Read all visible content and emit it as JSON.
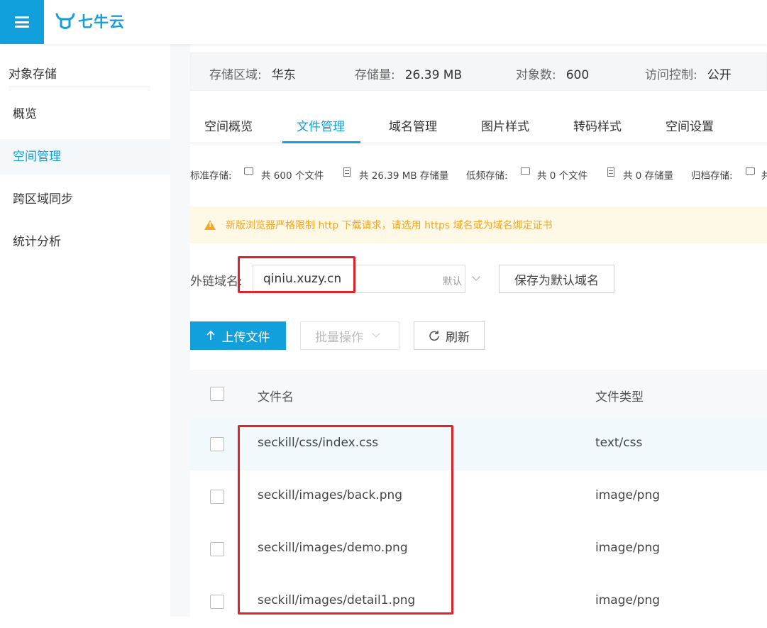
{
  "brand": {
    "logo_text": "七牛云"
  },
  "sidebar": {
    "title": "对象存储",
    "items": [
      {
        "label": "概览"
      },
      {
        "label": "空间管理"
      },
      {
        "label": "跨区域同步"
      },
      {
        "label": "统计分析"
      }
    ]
  },
  "stats": {
    "region_label": "存储区域:",
    "region_value": "华东",
    "size_label": "存储量:",
    "size_value": "26.39 MB",
    "objects_label": "对象数:",
    "objects_value": "600",
    "access_label": "访问控制:",
    "access_value": "公开"
  },
  "tabs": [
    {
      "label": "空间概览"
    },
    {
      "label": "文件管理"
    },
    {
      "label": "域名管理"
    },
    {
      "label": "图片样式"
    },
    {
      "label": "转码样式"
    },
    {
      "label": "空间设置"
    }
  ],
  "storage_info": {
    "standard_label": "标准存储:",
    "standard_files": "共 600 个文件",
    "standard_size": "共 26.39 MB 存储量",
    "low_label": "低频存储:",
    "low_files": "共 0 个文件",
    "low_size": "共 0 存储量",
    "archive_label": "归档存储:",
    "archive_files": "共"
  },
  "warning": {
    "text": "新版浏览器严格限制 http 下载请求，请选用 https 域名或为域名绑定证书"
  },
  "domain": {
    "label": "外链域名:",
    "value": "qiniu.xuzy.cn",
    "default_tag": "默认",
    "save_button": "保存为默认域名"
  },
  "actions": {
    "upload": "上传文件",
    "batch": "批量操作",
    "refresh": "刷新"
  },
  "table": {
    "columns": {
      "name": "文件名",
      "type": "文件类型"
    },
    "rows": [
      {
        "name": "seckill/css/index.css",
        "type": "text/css"
      },
      {
        "name": "seckill/images/back.png",
        "type": "image/png"
      },
      {
        "name": "seckill/images/demo.png",
        "type": "image/png"
      },
      {
        "name": "seckill/images/detail1.png",
        "type": "image/png"
      }
    ]
  },
  "colors": {
    "accent": "#11a0dc",
    "highlight": "#e0222a",
    "warning": "#f5a623"
  }
}
